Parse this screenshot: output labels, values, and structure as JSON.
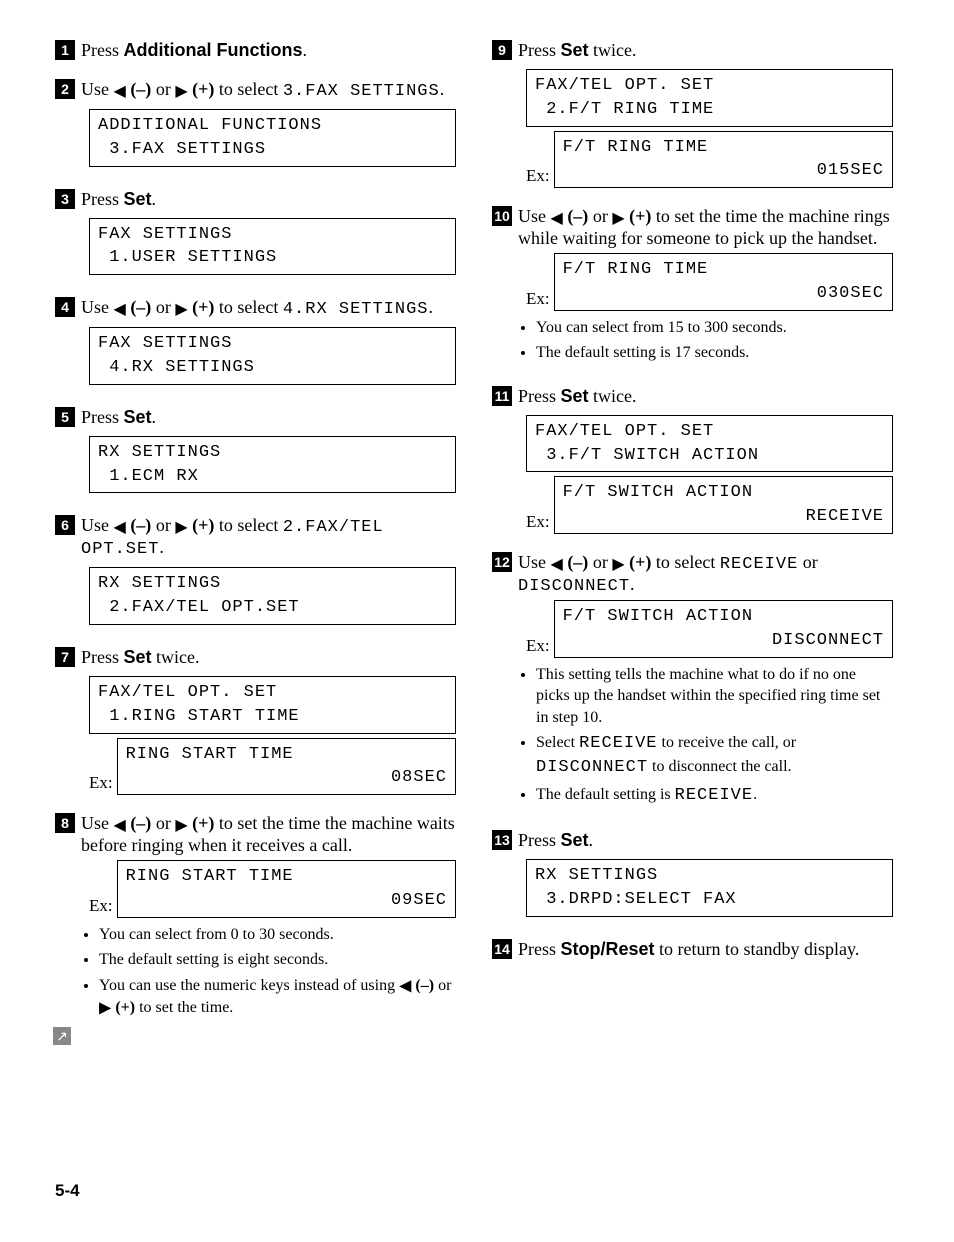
{
  "left": {
    "s1": {
      "num": "1",
      "text_a": "Press ",
      "bold": "Additional Functions",
      "text_b": "."
    },
    "s2": {
      "num": "2",
      "text_a": "Use ",
      "minus": "(–)",
      "or": " or ",
      "plus": "(+)",
      "text_b": " to select ",
      "mono": "3.FAX SETTINGS",
      "text_c": ".",
      "lcd1": "ADDITIONAL FUNCTIONS",
      "lcd2": " 3.FAX SETTINGS"
    },
    "s3": {
      "num": "3",
      "text_a": "Press ",
      "bold": "Set",
      "text_b": ".",
      "lcd1": "FAX SETTINGS",
      "lcd2": " 1.USER SETTINGS"
    },
    "s4": {
      "num": "4",
      "text_a": "Use ",
      "minus": "(–)",
      "or": " or ",
      "plus": "(+)",
      "text_b": " to select ",
      "mono": "4.RX SETTINGS",
      "text_c": ".",
      "lcd1": "FAX SETTINGS",
      "lcd2": " 4.RX SETTINGS"
    },
    "s5": {
      "num": "5",
      "text_a": "Press ",
      "bold": "Set",
      "text_b": ".",
      "lcd1": "RX SETTINGS",
      "lcd2": " 1.ECM RX"
    },
    "s6": {
      "num": "6",
      "text_a": "Use ",
      "minus": "(–)",
      "or": " or ",
      "plus": "(+)",
      "text_b": " to select ",
      "mono": "2.FAX/TEL OPT.SET",
      "text_c": ".",
      "lcd1": "RX SETTINGS",
      "lcd2": " 2.FAX/TEL OPT.SET"
    },
    "s7": {
      "num": "7",
      "text_a": "Press ",
      "bold": "Set",
      "text_b": " twice.",
      "lcd1": "FAX/TEL OPT. SET",
      "lcd2": " 1.RING START TIME",
      "ex": "Ex:",
      "exlcd1": "RING START TIME",
      "exlcd2": "08SEC"
    },
    "s8": {
      "num": "8",
      "text_a": "Use ",
      "minus": "(–)",
      "or": " or ",
      "plus": "(+)",
      "text_b": " to set the time the machine waits before ringing when it receives a call.",
      "ex": "Ex:",
      "exlcd1": "RING START TIME",
      "exlcd2": "09SEC",
      "b1": "You can select from 0 to 30 seconds.",
      "b2": "The default setting is eight seconds.",
      "b3a": "You can use the numeric keys instead of using ",
      "b3_minus": "(–)",
      "b3_or": " or ",
      "b3_plus": "(+)",
      "b3b": " to set the time."
    }
  },
  "right": {
    "s9": {
      "num": "9",
      "text_a": "Press ",
      "bold": "Set",
      "text_b": " twice.",
      "lcd1": "FAX/TEL OPT. SET",
      "lcd2": " 2.F/T RING TIME",
      "ex": "Ex:",
      "exlcd1": "F/T RING TIME",
      "exlcd2": "015SEC"
    },
    "s10": {
      "num": "10",
      "text_a": "Use ",
      "minus": "(–)",
      "or": " or ",
      "plus": "(+)",
      "text_b": " to set the time the machine rings while waiting for someone to pick up the handset.",
      "ex": "Ex:",
      "exlcd1": "F/T RING TIME",
      "exlcd2": "030SEC",
      "b1": "You can select from 15 to 300 seconds.",
      "b2": "The default setting is 17 seconds."
    },
    "s11": {
      "num": "11",
      "text_a": "Press ",
      "bold": "Set",
      "text_b": " twice.",
      "lcd1": "FAX/TEL OPT. SET",
      "lcd2": " 3.F/T SWITCH ACTION",
      "ex": "Ex:",
      "exlcd1": "F/T SWITCH ACTION",
      "exlcd2": "RECEIVE"
    },
    "s12": {
      "num": "12",
      "text_a": "Use ",
      "minus": "(–)",
      "or": " or ",
      "plus": "(+)",
      "text_b": " to select ",
      "mono1": "RECEIVE",
      "text_c": " or ",
      "mono2": "DISCONNECT",
      "text_d": ".",
      "ex": "Ex:",
      "exlcd1": "F/T SWITCH ACTION",
      "exlcd2": "DISCONNECT",
      "b1": "This setting tells the machine what to do if no one picks up the handset within the specified ring time set in step 10.",
      "b2a": "Select ",
      "b2m1": "RECEIVE",
      "b2b": " to receive the call, or ",
      "b2m2": "DISCONNECT",
      "b2c": " to disconnect the call.",
      "b3a": "The default setting is ",
      "b3m": "RECEIVE",
      "b3b": "."
    },
    "s13": {
      "num": "13",
      "text_a": "Press ",
      "bold": "Set",
      "text_b": ".",
      "lcd1": "RX SETTINGS",
      "lcd2": " 3.DRPD:SELECT FAX"
    },
    "s14": {
      "num": "14",
      "text_a": "Press ",
      "bold": "Stop/Reset",
      "text_b": " to return to standby display."
    }
  },
  "page": "5-4",
  "glyph": {
    "left": "◀",
    "right": "▶",
    "tab": "↗"
  }
}
